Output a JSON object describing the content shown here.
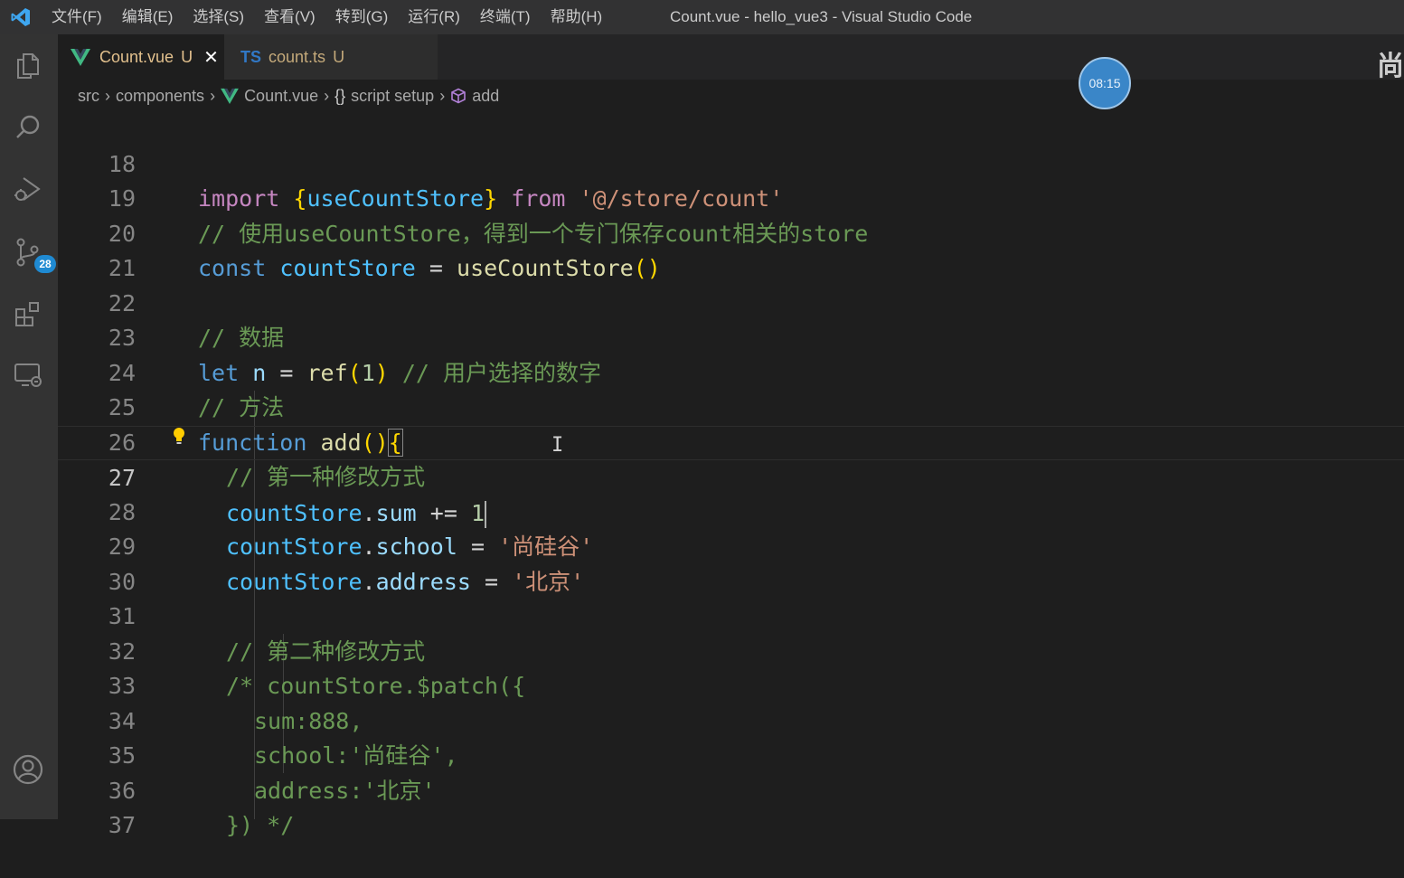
{
  "window": {
    "title": "Count.vue - hello_vue3 - Visual Studio Code",
    "menu": [
      "文件(F)",
      "编辑(E)",
      "选择(S)",
      "查看(V)",
      "转到(G)",
      "运行(R)",
      "终端(T)",
      "帮助(H)"
    ]
  },
  "activity_bar": {
    "icons": [
      "explorer-icon",
      "search-icon",
      "run-debug-icon",
      "source-control-icon",
      "extensions-icon",
      "remote-explorer-icon",
      "accounts-icon"
    ],
    "source_control_badge": "28"
  },
  "tabs": [
    {
      "label": "Count.vue",
      "status": "U",
      "active": true,
      "icon": "vue-icon"
    },
    {
      "label": "count.ts",
      "status": "U",
      "active": false,
      "icon_text": "TS"
    }
  ],
  "right_edge_glyph": "尚",
  "breadcrumb": [
    "src",
    "components",
    "Count.vue",
    "script setup",
    "add"
  ],
  "breadcrumb_icons": {
    "vue": "V",
    "braces": "{}"
  },
  "timer": "08:15",
  "editor": {
    "current_line": 27,
    "lines": [
      {
        "n": "18"
      },
      {
        "n": "19"
      },
      {
        "n": "20"
      },
      {
        "n": "21"
      },
      {
        "n": "22"
      },
      {
        "n": "23"
      },
      {
        "n": "24"
      },
      {
        "n": "25"
      },
      {
        "n": "26"
      },
      {
        "n": "27"
      },
      {
        "n": "28"
      },
      {
        "n": "29"
      },
      {
        "n": "30"
      },
      {
        "n": "31"
      },
      {
        "n": "32"
      },
      {
        "n": "33"
      },
      {
        "n": "34"
      },
      {
        "n": "35"
      },
      {
        "n": "36"
      },
      {
        "n": "37"
      }
    ],
    "tokens": {
      "import": "import",
      "useCountStore_braced": "useCountStore",
      "from": "from",
      "path": "'@/store/count'",
      "c19": "// 使用useCountStore，得到一个专门保存count相关的store",
      "const": "const",
      "countStore": "countStore",
      "eq": "=",
      "useCountStore_call": "useCountStore",
      "c22": "// 数据",
      "let": "let",
      "n": "n",
      "ref": "ref",
      "one": "1",
      "c23": "// 用户选择的数字",
      "c24": "// 方法",
      "function": "function",
      "add": "add",
      "c26": "// 第一种修改方式",
      "sum": "sum",
      "plus_eq": "+=",
      "school": "school",
      "school_val": "'尚硅谷'",
      "address": "address",
      "address_val": "'北京'",
      "c31": "// 第二种修改方式",
      "c32": "/* countStore.$patch({",
      "c33": "sum:888,",
      "c34": "school:'尚硅谷',",
      "c35": "address:'北京'",
      "c36": "}) */"
    }
  }
}
